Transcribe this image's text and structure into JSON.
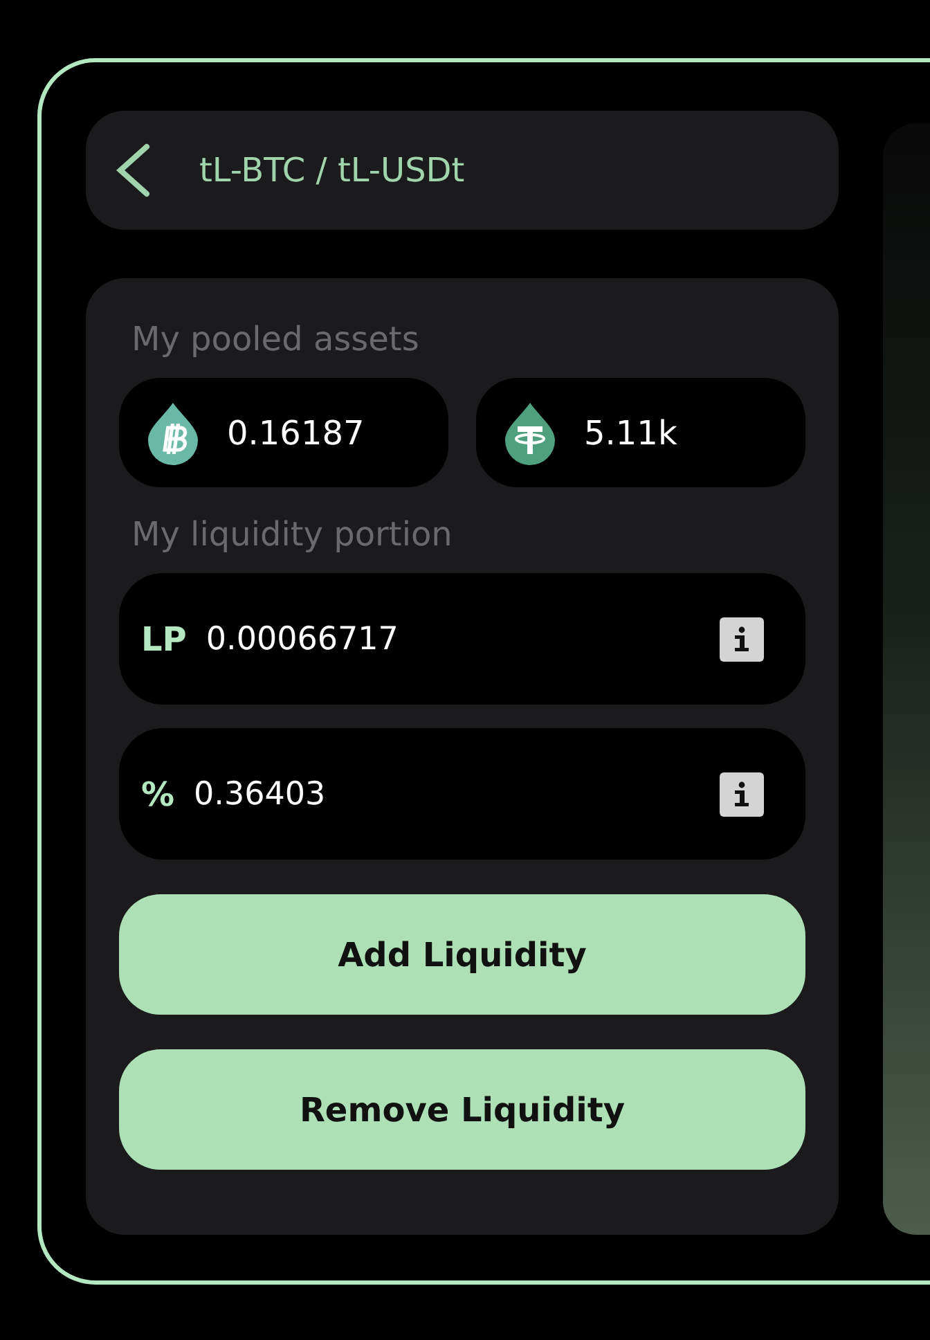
{
  "header": {
    "title": "tL-BTC / tL-USDt"
  },
  "pooled": {
    "label": "My pooled assets",
    "assets": [
      {
        "kind": "btc",
        "amount": "0.16187"
      },
      {
        "kind": "usdt",
        "amount": "5.11k"
      }
    ]
  },
  "portion": {
    "label": "My liquidity portion",
    "rows": [
      {
        "symbol": "LP",
        "value": "0.00066717"
      },
      {
        "symbol": "%",
        "value": "0.36403"
      }
    ]
  },
  "buttons": [
    {
      "label": "Add Liquidity"
    },
    {
      "label": "Remove Liquidity"
    }
  ]
}
